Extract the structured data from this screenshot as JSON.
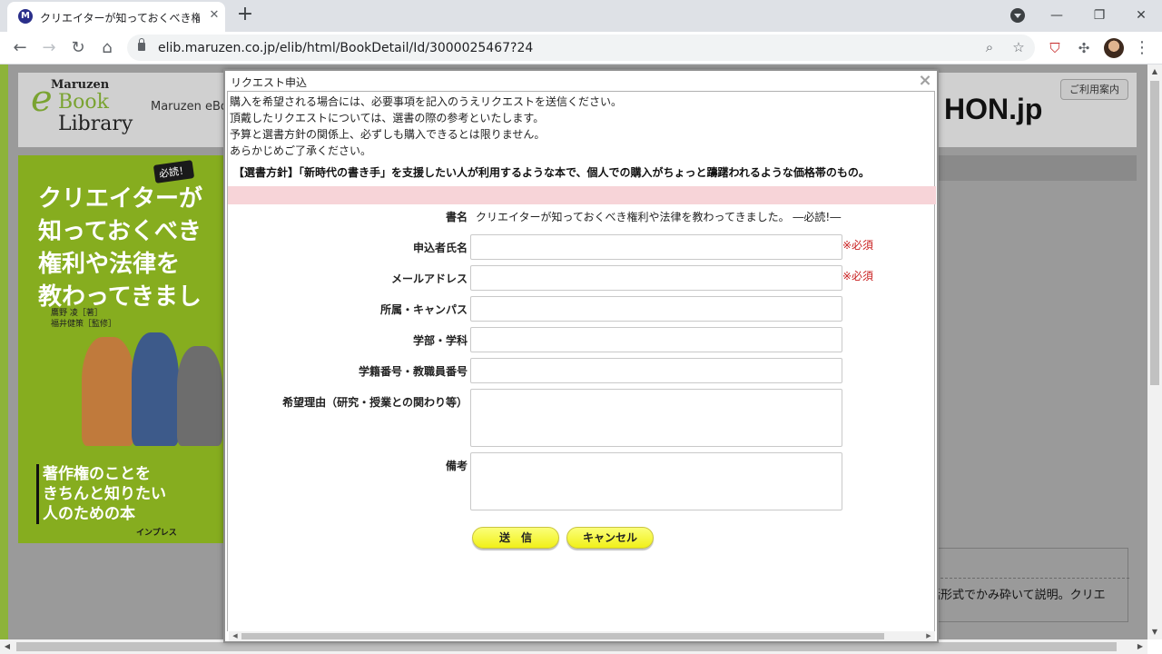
{
  "browser": {
    "tab_title": "クリエイターが知っておくべき権利や法",
    "tab_favicon": "M",
    "url": "elib.maruzen.co.jp/elib/html/BookDetail/Id/3000025467?24"
  },
  "site": {
    "logo": {
      "maruzen": "Maruzen",
      "ebook": "Book",
      "library": "Library",
      "e": "e"
    },
    "header_text": "Maruzen eBoo",
    "partner_logo": "HON.jp",
    "help_button": "ご利用案内",
    "cover": {
      "badge": "必読！",
      "title_lines": [
        "クリエイターが",
        "知っておくべき",
        "権利や法律を",
        "教わってきまし"
      ],
      "authors": [
        "鷹野 凌［著］",
        "福井健策［監修］"
      ],
      "subtitle_lines": [
        "著作権のことを",
        "きちんと知りたい",
        "人のための本"
      ],
      "publisher": "インプレス"
    },
    "description_fragment": "話形式でかみ砕いて説明。クリエ"
  },
  "modal": {
    "title": "リクエスト申込",
    "close_glyph": "×",
    "intro_lines": [
      "購入を希望される場合には、必要事項を記入のうえリクエストを送信ください。",
      "頂戴したリクエストについては、選書の際の参考といたします。",
      "予算と選書方針の関係上、必ずしも購入できるとは限りません。",
      "あらかじめご了承ください。"
    ],
    "policy": "【選書方針】「新時代の書き手」を支援したい人が利用するような本で、個人での購入がちょっと躊躇われるような価格帯のもの。",
    "form": {
      "book_label": "書名",
      "book_value": "クリエイターが知っておくべき権利や法律を教わってきました。 ―必読!―",
      "name_label": "申込者氏名",
      "name_value": "",
      "email_label": "メールアドレス",
      "email_value": "",
      "campus_label": "所属・キャンパス",
      "campus_value": "",
      "department_label": "学部・学科",
      "department_value": "",
      "id_label": "学籍番号・教職員番号",
      "id_value": "",
      "reason_label": "希望理由（研究・授業との関わり等）",
      "reason_value": "",
      "notes_label": "備考",
      "notes_value": "",
      "required_mark": "※必須"
    },
    "submit_label": "送　信",
    "cancel_label": "キャンセル"
  }
}
